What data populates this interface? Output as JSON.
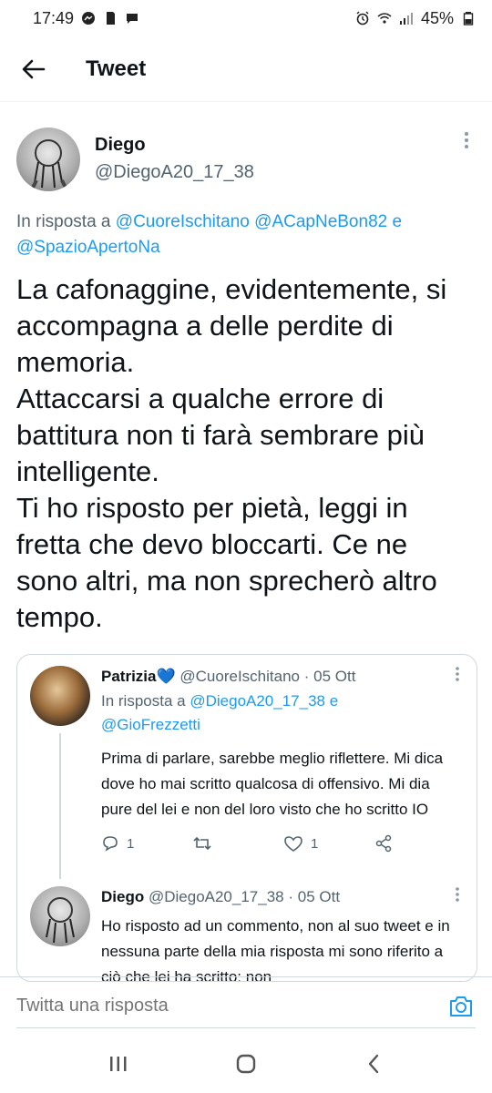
{
  "status_bar": {
    "time": "17:49",
    "battery": "45%",
    "left_icons": [
      "messenger-icon",
      "sd-card-icon",
      "chat-icon"
    ],
    "right_icons": [
      "alarm-icon",
      "wifi-icon",
      "signal-icon",
      "battery-icon"
    ]
  },
  "top_bar": {
    "title": "Tweet"
  },
  "tweet": {
    "author_name": "Diego",
    "author_handle": "@DiegoA20_17_38",
    "reply_prefix": "In risposta a",
    "reply_links": [
      "@CuoreIschitano",
      "@ACapNeBon82"
    ],
    "reply_and": "e",
    "reply_link_last": "@SpazioApertoNa",
    "body": [
      "La cafonaggine, evidentemente, si accompagna a delle perdite di memoria.",
      "Attaccarsi a qualche errore di battitura non ti farà sembrare più intelligente.",
      "Ti ho risposto per pietà, leggi in fretta che devo bloccarti. Ce ne sono altri, ma non sprecherò altro tempo."
    ]
  },
  "thread": [
    {
      "name": "Patrizia",
      "verified_emoji": "💙",
      "handle": "@CuoreIschitano",
      "dot": "·",
      "date": "05 Ott",
      "reply_prefix": "In risposta a",
      "reply_link_1": "@DiegoA20_17_38",
      "reply_and": "e",
      "reply_link_2": "@GioFrezzetti",
      "text": "Prima di parlare, sarebbe meglio riflettere. Mi dica dove ho mai scritto qualcosa di offensivo. Mi dia pure del lei e non del loro visto che ho scritto IO",
      "replies": "1",
      "retweets": "",
      "likes": "1"
    },
    {
      "name": "Diego",
      "handle": "@DiegoA20_17_38",
      "dot": "·",
      "date": "05 Ott",
      "text": "Ho risposto ad un commento, non al suo tweet e in nessuna parte della mia risposta mi sono riferito a ciò che lei ha scritto; non"
    }
  ],
  "reply_bar": {
    "placeholder": "Twitta una risposta"
  },
  "colors": {
    "accent": "#1d9bf0",
    "secondary_text": "#536471",
    "border": "#cfd9de"
  }
}
